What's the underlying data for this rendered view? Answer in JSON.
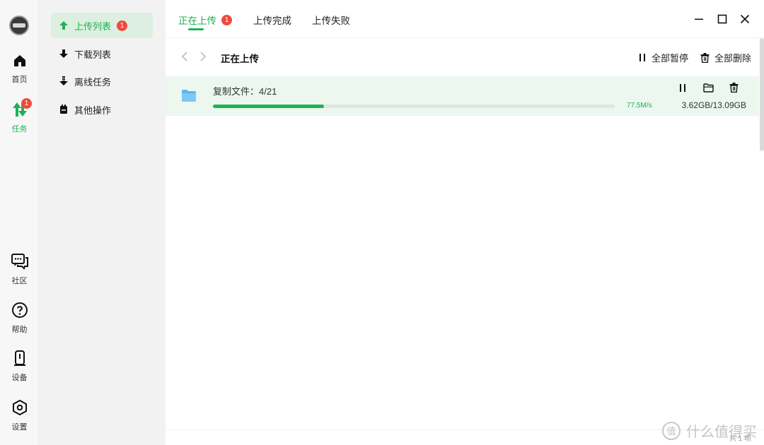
{
  "rail": {
    "items": [
      {
        "label": "首页"
      },
      {
        "label": "任务",
        "badge": "1"
      },
      {
        "label": "社区"
      },
      {
        "label": "帮助"
      },
      {
        "label": "设备"
      },
      {
        "label": "设置"
      }
    ]
  },
  "subnav": {
    "items": [
      {
        "label": "上传列表",
        "badge": "1"
      },
      {
        "label": "下载列表"
      },
      {
        "label": "离线任务"
      },
      {
        "label": "其他操作"
      }
    ]
  },
  "tabs": [
    {
      "label": "正在上传",
      "badge": "1"
    },
    {
      "label": "上传完成"
    },
    {
      "label": "上传失败"
    }
  ],
  "toolbar": {
    "title": "正在上传",
    "pause_all": "全部暂停",
    "delete_all": "全部删除"
  },
  "task": {
    "name": "复制文件：4/21",
    "speed": "77.5M/s",
    "size": "3.62GB/13.09GB",
    "progress": 0.277
  },
  "footer": {
    "count": "共 1 项",
    "watermark": "值 什么值得买"
  },
  "colors": {
    "accent": "#1fb155",
    "badge": "#f04a3e",
    "row_highlight": "#ebf7ef",
    "folder": "#5cb8f0"
  }
}
